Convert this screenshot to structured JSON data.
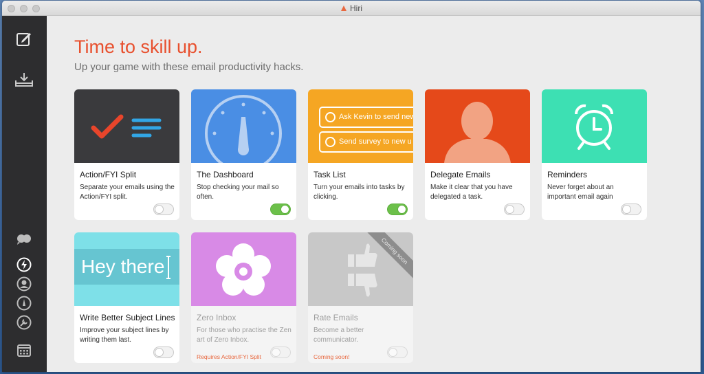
{
  "window": {
    "title": "Hiri"
  },
  "sidebar": {
    "top_icons": [
      "compose-icon",
      "inbox-download-icon"
    ],
    "bottom_icons": [
      "conversations-icon",
      "skills-lightning-icon",
      "contacts-icon",
      "dashboard-gauge-icon",
      "settings-wrench-icon",
      "calendar-icon"
    ]
  },
  "main": {
    "headline": "Time to skill up.",
    "subhead": "Up your game with these email productivity hacks."
  },
  "cards": [
    {
      "name": "Action/FYI Split",
      "desc": "Separate your emails using the Action/FYI split.",
      "toggle": "off",
      "art_color": "#3a3a3d"
    },
    {
      "name": "The Dashboard",
      "desc": "Stop checking your mail so often.",
      "toggle": "on",
      "art_color": "#4a8ee4"
    },
    {
      "name": "Task List",
      "desc": "Turn your emails into tasks by clicking.",
      "toggle": "on",
      "art_color": "#f5a623",
      "tasks": [
        "Ask Kevin to send new",
        "Send survey to new u"
      ]
    },
    {
      "name": "Delegate Emails",
      "desc": "Make it clear that you have delegated a task.",
      "toggle": "off",
      "art_color": "#e5491a"
    },
    {
      "name": "Reminders",
      "desc": "Never forget about an important email again",
      "toggle": "off",
      "art_color": "#3de0b3"
    },
    {
      "name": "Write Better Subject Lines",
      "desc": "Improve your subject lines by writing them last.",
      "toggle": "off",
      "art_color": "#7ee0e8",
      "art_text": "Hey there"
    },
    {
      "name": "Zero Inbox",
      "desc": "For those who practise the Zen art of Zero Inbox.",
      "toggle": "off",
      "art_color": "#d88ae6",
      "note": "Requires Action/FYI Split",
      "disabled": true
    },
    {
      "name": "Rate Emails",
      "desc": "Become a better communicator.",
      "toggle": "off",
      "art_color": "#c8c8c8",
      "note": "Coming soon!",
      "ribbon": "Coming soon",
      "disabled": true
    }
  ]
}
